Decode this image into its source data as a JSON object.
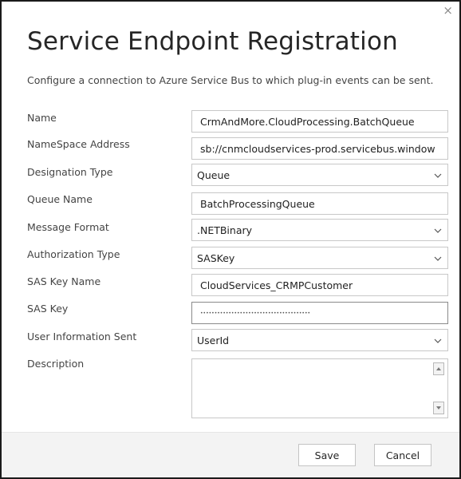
{
  "dialog": {
    "title": "Service Endpoint Registration",
    "subtitle": "Configure a connection to Azure Service Bus to which plug-in events can be sent.",
    "close_glyph": "×"
  },
  "fields": {
    "name": {
      "label": "Name",
      "value": "CrmAndMore.CloudProcessing.BatchQueue"
    },
    "namespace_address": {
      "label": "NameSpace Address",
      "value": "sb://cnmcloudservices-prod.servicebus.window"
    },
    "designation_type": {
      "label": "Designation Type",
      "value": "Queue"
    },
    "queue_name": {
      "label": "Queue Name",
      "value": "BatchProcessingQueue"
    },
    "message_format": {
      "label": "Message Format",
      "value": ".NETBinary"
    },
    "authorization_type": {
      "label": "Authorization Type",
      "value": "SASKey"
    },
    "sas_key_name": {
      "label": "SAS Key Name",
      "value": "CloudServices_CRMPCustomer"
    },
    "sas_key": {
      "label": "SAS Key",
      "value": "•••••••••••••••••••••••••••••••••••••••"
    },
    "user_information_sent": {
      "label": "User Information Sent",
      "value": "UserId"
    },
    "description": {
      "label": "Description",
      "value": ""
    }
  },
  "footer": {
    "save_label": "Save",
    "cancel_label": "Cancel"
  },
  "colors": {
    "footer_bg": "#f3f3f3",
    "border": "#c8c8c8",
    "dialog_border": "#1a1a1a"
  },
  "icons": {
    "dropdown": "chevron-down-icon",
    "scroll_up": "scroll-up-icon",
    "scroll_down": "scroll-down-icon",
    "close": "close-icon"
  }
}
